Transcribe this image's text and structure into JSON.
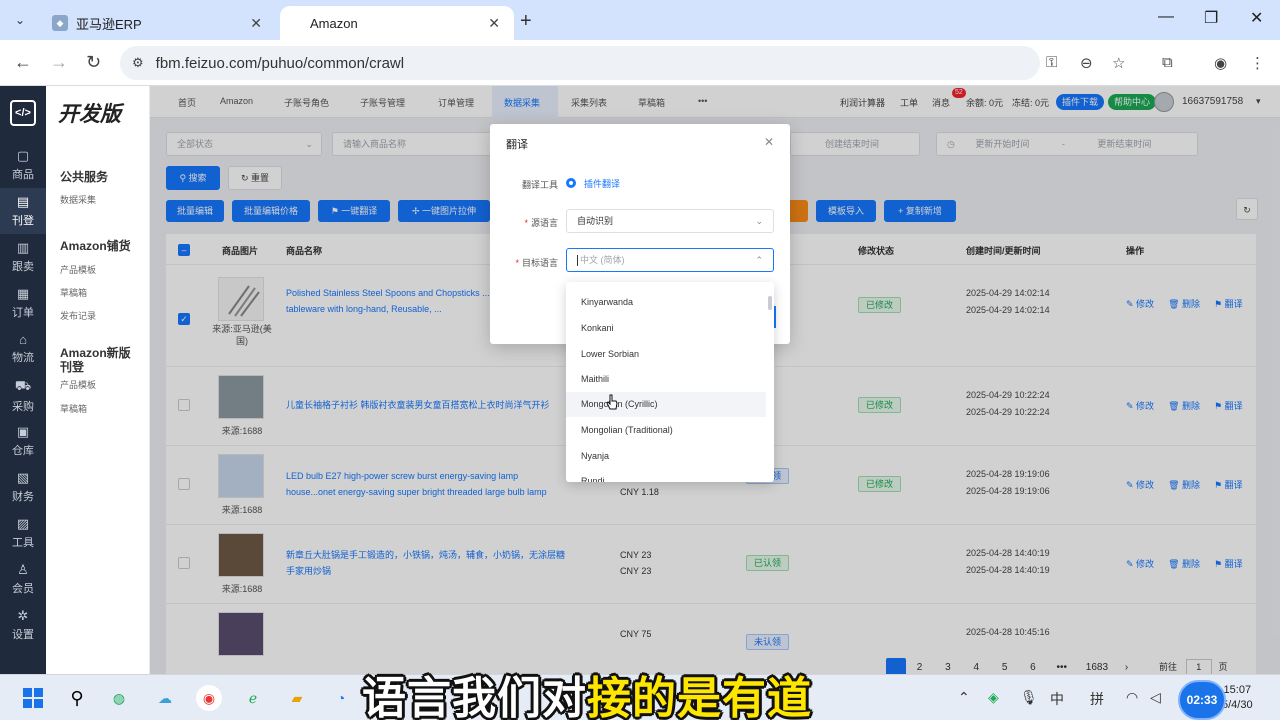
{
  "browser": {
    "tabs": [
      {
        "title": "亚马逊ERP"
      },
      {
        "title": "Amazon"
      }
    ],
    "url": "fbm.feizuo.com/puhuo/common/crawl"
  },
  "leftbar": {
    "items": [
      "商品",
      "刊登",
      "跟卖",
      "订单",
      "物流",
      "采购",
      "仓库",
      "财务",
      "工具",
      "会员",
      "设置"
    ]
  },
  "sidepanel": {
    "brand": "开发版",
    "groups": [
      {
        "title": "公共服务",
        "items": [
          "数据采集"
        ]
      },
      {
        "title": "Amazon铺货",
        "items": [
          "产品模板",
          "草稿箱",
          "发布记录"
        ]
      },
      {
        "title": "Amazon新版刊登",
        "items": [
          "产品模板",
          "草稿箱"
        ]
      }
    ]
  },
  "topnav": {
    "items": [
      "首页",
      "Amazon",
      "子账号角色",
      "子账号管理",
      "订单管理",
      "数据采集",
      "采集列表",
      "草稿箱"
    ],
    "more": "•••",
    "profit_calc": "利润计算器",
    "work_order": "工单",
    "message": "消息",
    "message_badge": "52",
    "balance": "余额: 0元",
    "frozen": "冻结: 0元",
    "plugin_download": "插件下载",
    "help_center": "帮助中心",
    "phone": "16637591758"
  },
  "filters": {
    "status_placeholder": "全部状态",
    "name_placeholder": "请输入商品名称",
    "create_end": "创建结束时间",
    "update_start": "更新开始时间",
    "update_end": "更新结束时间",
    "dash": "-"
  },
  "buttons": {
    "search": "搜索",
    "reset": "重置",
    "batch_edit": "批量编辑",
    "batch_edit_price": "批量编辑价格",
    "one_click_translate": "一键翻译",
    "one_click_image": "一键图片拉伸",
    "template_import": "模板导入",
    "copy_new": "复制新增"
  },
  "table": {
    "headers": {
      "image": "商品图片",
      "name": "商品名称",
      "modify_status": "修改状态",
      "time": "创建时间/更新时间",
      "actions": "操作"
    },
    "actions": {
      "edit": "修改",
      "delete": "删除",
      "translate": "翻译"
    },
    "rows": [
      {
        "checked": true,
        "source": "来源:亚马逊(美国)",
        "name": "Polished Stainless Steel Spoons and Chopsticks ...d Spoons tableware with long-hand, Reusable, ...",
        "price": "",
        "status": "",
        "modify": "已修改",
        "created": "2025-04-29 14:02:14",
        "updated": "2025-04-29 14:02:14"
      },
      {
        "checked": false,
        "source": "来源:1688",
        "name": "儿童长袖格子衬衫 韩版衬衣童装男女童百搭宽松上衣时尚洋气开衫",
        "price": "",
        "status": "",
        "modify": "已修改",
        "created": "2025-04-29 10:22:24",
        "updated": "2025-04-29 10:22:24"
      },
      {
        "checked": false,
        "source": "来源:1688",
        "name": "LED bulb E27 high-power screw burst energy-saving lamp house...onet energy-saving super bright threaded large bulb lamp",
        "price": "CNY 1.18",
        "status": "未认领",
        "modify": "已修改",
        "created": "2025-04-28 19:19:06",
        "updated": "2025-04-28 19:19:06"
      },
      {
        "checked": false,
        "source": "来源:1688",
        "name": "新章丘大肚锅是手工锻造的，小铁锅，炖汤，辅食，小奶锅，无涂层糖手家用炒锅",
        "price": "CNY 23",
        "price2": "CNY 23",
        "status": "已认领",
        "modify": "",
        "created": "2025-04-28 14:40:19",
        "updated": "2025-04-28 14:40:19"
      },
      {
        "checked": false,
        "source": "",
        "name": "",
        "price": "CNY 75",
        "status": "未认领",
        "modify": "",
        "created": "2025-04-28 10:45:16",
        "updated": ""
      }
    ]
  },
  "pager": {
    "pages": [
      "2",
      "3",
      "4",
      "5",
      "6"
    ],
    "ellipsis": "•••",
    "last": "1683",
    "goto_label": "前往",
    "goto_value": "1",
    "page_suffix": "页"
  },
  "modal": {
    "title": "翻译",
    "tool_label": "翻译工具",
    "tool_option": "插件翻译",
    "source_label": "源语言",
    "source_value": "自动识别",
    "target_label": "目标语言",
    "target_placeholder": "中文 (简体)",
    "options": [
      "Kinyarwanda",
      "Konkani",
      "Lower Sorbian",
      "Maithili",
      "Mongolian (Cyrillic)",
      "Mongolian (Traditional)",
      "Nyanja",
      "Rundi"
    ],
    "hovered_option": "Mongolian (Cyrillic)"
  },
  "taskbar": {
    "ime_lang": "中",
    "ime_mode": "拼",
    "time": "15:07",
    "date": "5/4/30",
    "record_time": "02:33"
  },
  "subtitle": {
    "part1": "语言我们对",
    "part2": "接的是有道"
  }
}
